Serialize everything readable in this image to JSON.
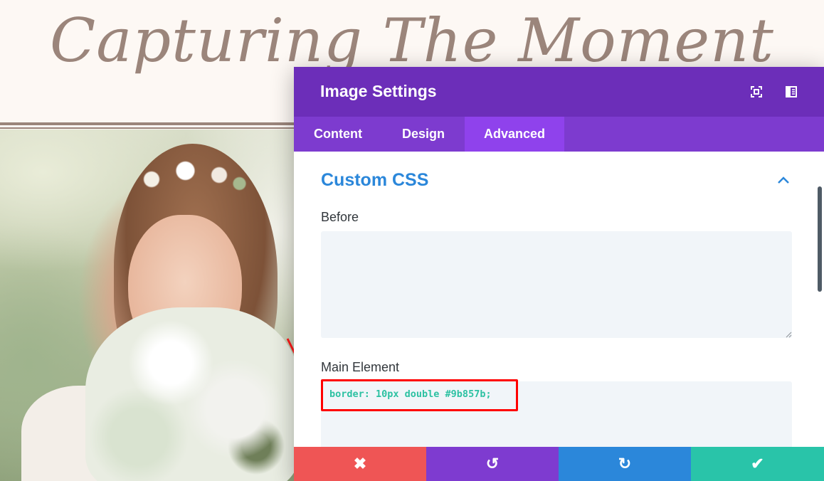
{
  "site": {
    "title": "Capturing The Moment"
  },
  "modal": {
    "title": "Image Settings",
    "header_icons": [
      "expand-icon",
      "split-view-icon"
    ],
    "tabs": [
      {
        "label": "Content",
        "active": false
      },
      {
        "label": "Design",
        "active": false
      },
      {
        "label": "Advanced",
        "active": true
      }
    ],
    "section": {
      "title": "Custom CSS",
      "expanded": true
    },
    "fields": {
      "before": {
        "label": "Before",
        "value": ""
      },
      "main_element": {
        "label": "Main Element",
        "value": "border: 10px double #9b857b;"
      }
    },
    "footer": {
      "discard": "✖",
      "undo": "↺",
      "redo": "↻",
      "save": "✔"
    }
  },
  "colors": {
    "header": "#6c2eb9",
    "tabbar": "#7d3bcf",
    "tab_active": "#8f42ec",
    "section_title": "#2b87da",
    "code": "#2cc1a2",
    "discard": "#ef5555",
    "undo": "#7e3bd0",
    "redo": "#2b87da",
    "save": "#29c4a9",
    "highlight": "#ff0000",
    "site_accent": "#9b857b"
  }
}
